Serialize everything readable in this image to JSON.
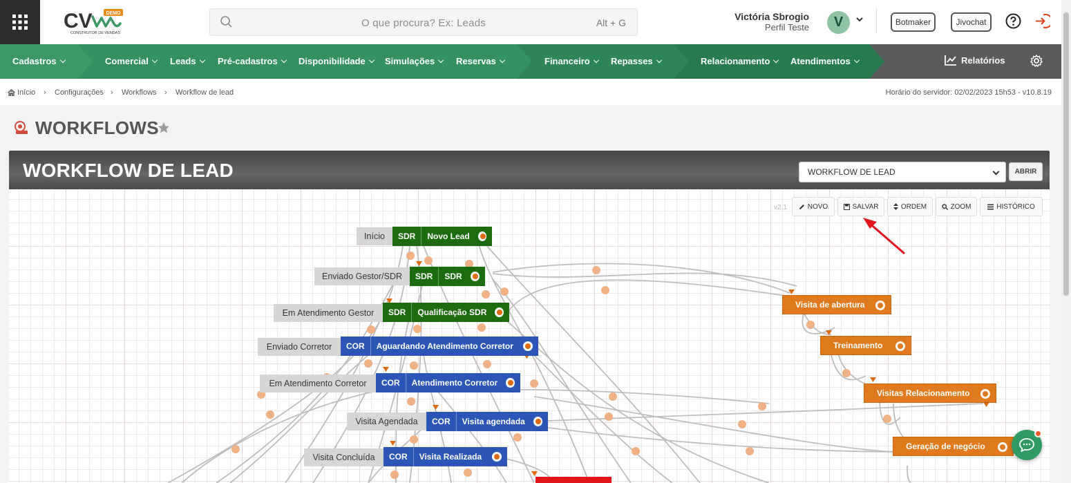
{
  "header": {
    "search_placeholder": "O que procura? Ex: Leads",
    "search_shortcut": "Alt + G",
    "user_name": "Victória Sbrogio",
    "user_profile": "Perfil Teste",
    "avatar_letter": "V",
    "botmaker_label": "Botmaker",
    "jivochat_label": "Jivochat",
    "logo_text": "CV",
    "logo_badge": "DEMO",
    "logo_subtext": "CONSTRUTOR DE VENDAS"
  },
  "nav": {
    "items": [
      "Cadastros",
      "Comercial",
      "Leads",
      "Pré-cadastros",
      "Disponibilidade",
      "Simulações",
      "Reservas",
      "Financeiro",
      "Repasses",
      "Relacionamento",
      "Atendimentos"
    ],
    "reports_label": "Relatórios"
  },
  "breadcrumb": {
    "items": [
      "Início",
      "Configurações",
      "Workflows",
      "Workflow de lead"
    ],
    "server_time": "Horário do servidor: 02/02/2023 15h53 - v10.8.19"
  },
  "page": {
    "title": "WORKFLOWS"
  },
  "panel": {
    "title": "WORKFLOW DE LEAD",
    "select_value": "WORKFLOW DE LEAD",
    "open_label": "ABRIR",
    "version": "v2.1",
    "toolbar": {
      "novo": "NOVO",
      "salvar": "SALVAR",
      "ordem": "ORDEM",
      "zoom": "ZOOM",
      "historico": "HISTÓRICO"
    }
  },
  "workflow": {
    "states": [
      {
        "tag": "Início",
        "group": "SDR",
        "label": "Novo Lead",
        "color": "green"
      },
      {
        "tag": "Enviado Gestor/SDR",
        "group": "SDR",
        "label": "SDR",
        "color": "green"
      },
      {
        "tag": "Em Atendimento Gestor",
        "group": "SDR",
        "label": "Qualificação SDR",
        "color": "green"
      },
      {
        "tag": "Enviado Corretor",
        "group": "COR",
        "label": "Aguardando Atendimento Corretor",
        "color": "blue"
      },
      {
        "tag": "Em Atendimento Corretor",
        "group": "COR",
        "label": "Atendimento Corretor",
        "color": "blue"
      },
      {
        "tag": "Visita Agendada",
        "group": "COR",
        "label": "Visita agendada",
        "color": "blue"
      },
      {
        "tag": "Visita Concluída",
        "group": "COR",
        "label": "Visita Realizada",
        "color": "blue"
      }
    ],
    "orange_states": [
      "Visita de abertura",
      "Treinamento",
      "Visitas Relacionamento",
      "Geração de negócio"
    ]
  },
  "colors": {
    "nav_green": "#3c9966",
    "node_green": "#1d6b0f",
    "node_blue": "#2b56b8",
    "node_orange": "#e07a1c",
    "annotation_arrow": "#e3131b"
  }
}
